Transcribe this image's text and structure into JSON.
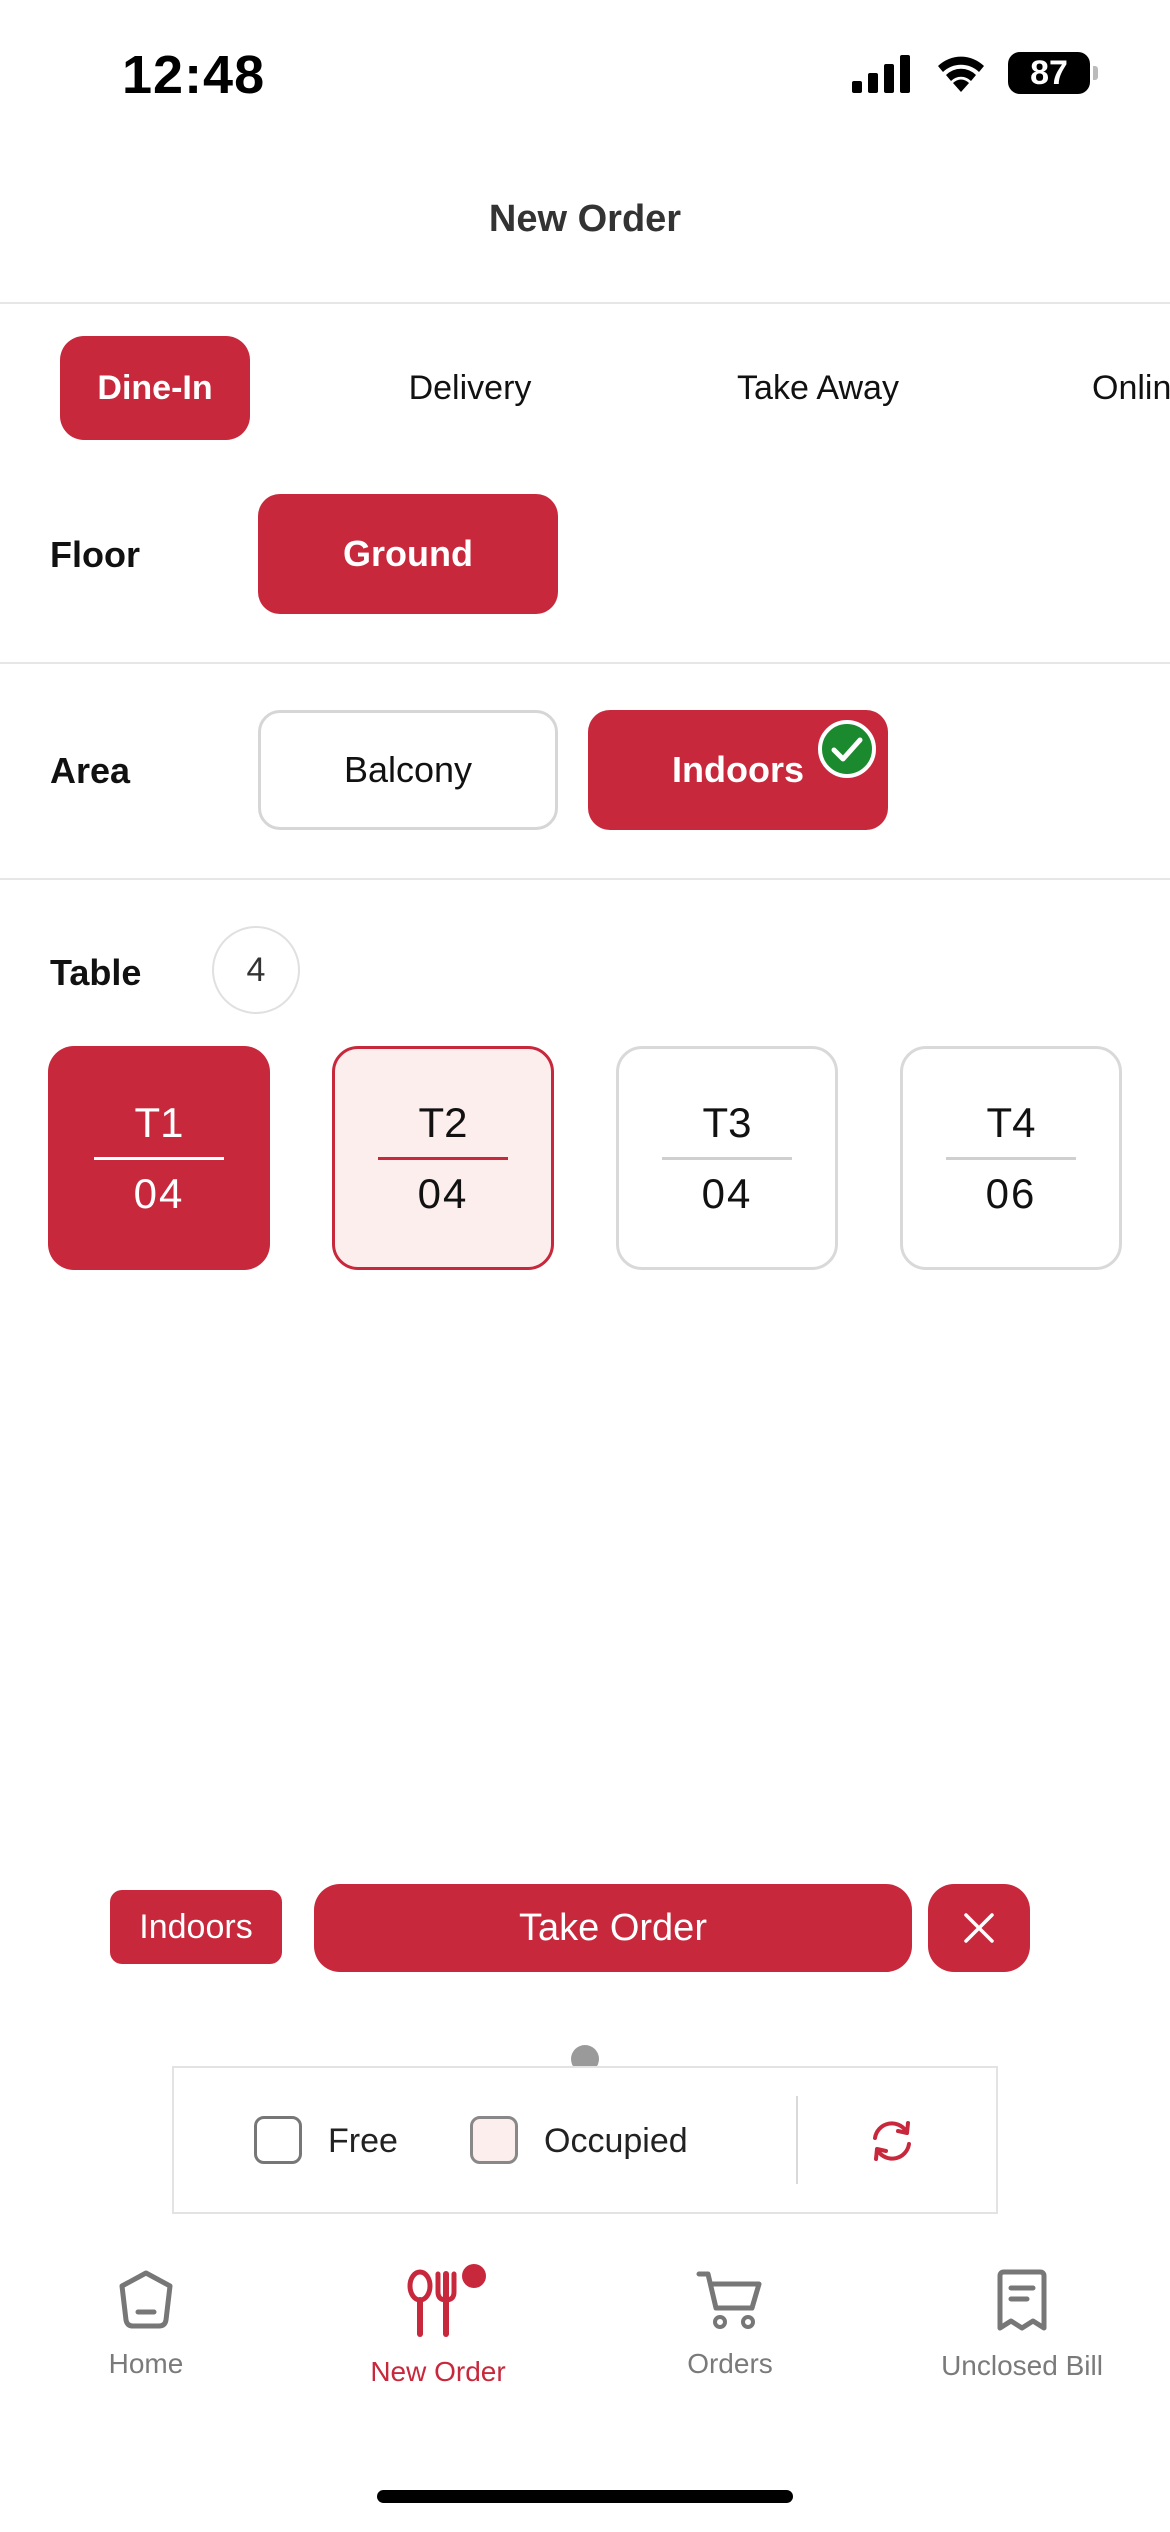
{
  "status_bar": {
    "time": "12:48",
    "battery": "87"
  },
  "header": {
    "title": "New Order"
  },
  "order_types": [
    {
      "label": "Dine-In",
      "active": true
    },
    {
      "label": "Delivery",
      "active": false
    },
    {
      "label": "Take Away",
      "active": false
    },
    {
      "label": "Online",
      "active": false
    }
  ],
  "floor": {
    "label": "Floor",
    "options": [
      "Ground"
    ],
    "selected": "Ground"
  },
  "area": {
    "label": "Area",
    "options": [
      "Balcony",
      "Indoors"
    ],
    "selected": "Indoors"
  },
  "tables": {
    "label": "Table",
    "count": "4",
    "items": [
      {
        "name": "T1",
        "seats": "04",
        "state": "selected"
      },
      {
        "name": "T2",
        "seats": "04",
        "state": "occupied"
      },
      {
        "name": "T3",
        "seats": "04",
        "state": "free"
      },
      {
        "name": "T4",
        "seats": "06",
        "state": "free"
      }
    ]
  },
  "action_bar": {
    "area_chip": "Indoors",
    "take_order_label": "Take Order"
  },
  "legend": {
    "free_label": "Free",
    "occupied_label": "Occupied"
  },
  "bottom_nav": [
    {
      "label": "Home",
      "icon": "home-icon",
      "active": false
    },
    {
      "label": "New Order",
      "icon": "cutlery-icon",
      "active": true
    },
    {
      "label": "Orders",
      "icon": "cart-icon",
      "active": false
    },
    {
      "label": "Unclosed Bill",
      "icon": "receipt-icon",
      "active": false
    }
  ],
  "colors": {
    "accent": "#c8283c",
    "occupied_fill": "#fdeeee",
    "success": "#1b8a2e"
  }
}
